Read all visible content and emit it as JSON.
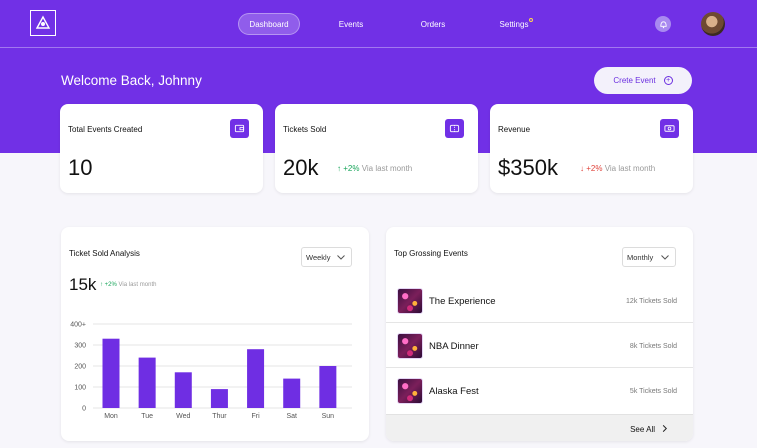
{
  "nav": {
    "items": [
      "Dashboard",
      "Events",
      "Orders",
      "Settings"
    ]
  },
  "welcome": "Welcome Back, Johnny",
  "create_button": "Crete Event",
  "stats": [
    {
      "title": "Total Events Created",
      "value": "10",
      "icon": "wallet-icon"
    },
    {
      "title": "Tickets Sold",
      "value": "20k",
      "change": "+2%",
      "direction": "up",
      "via": "Via last month",
      "icon": "ticket-icon"
    },
    {
      "title": "Revenue",
      "value": "$350k",
      "change": "+2%",
      "direction": "down",
      "via": "Via last month",
      "icon": "money-icon"
    }
  ],
  "analysis": {
    "title": "Ticket Sold Analysis",
    "period": "Weekly",
    "value": "15k",
    "change": "+2%",
    "via": "Via last month"
  },
  "chart_data": {
    "type": "bar",
    "categories": [
      "Mon",
      "Tue",
      "Wed",
      "Thur",
      "Fri",
      "Sat",
      "Sun"
    ],
    "values": [
      330,
      240,
      170,
      90,
      280,
      140,
      200
    ],
    "y_ticks": [
      "0",
      "100",
      "200",
      "300",
      "400+"
    ],
    "ylim": [
      0,
      400
    ],
    "grid": true,
    "bar_color": "#6f2ee3"
  },
  "top_events": {
    "title": "Top Grossing Events",
    "period": "Monthly",
    "items": [
      {
        "name": "The Experience",
        "sold": "12k Tickets Sold"
      },
      {
        "name": "NBA Dinner",
        "sold": "8k Tickets Sold"
      },
      {
        "name": "Alaska Fest",
        "sold": "5k Tickets Sold"
      }
    ],
    "see_all": "See All"
  },
  "colors": {
    "primary": "#7130e6",
    "up": "#18a55a",
    "down": "#e0433b"
  }
}
